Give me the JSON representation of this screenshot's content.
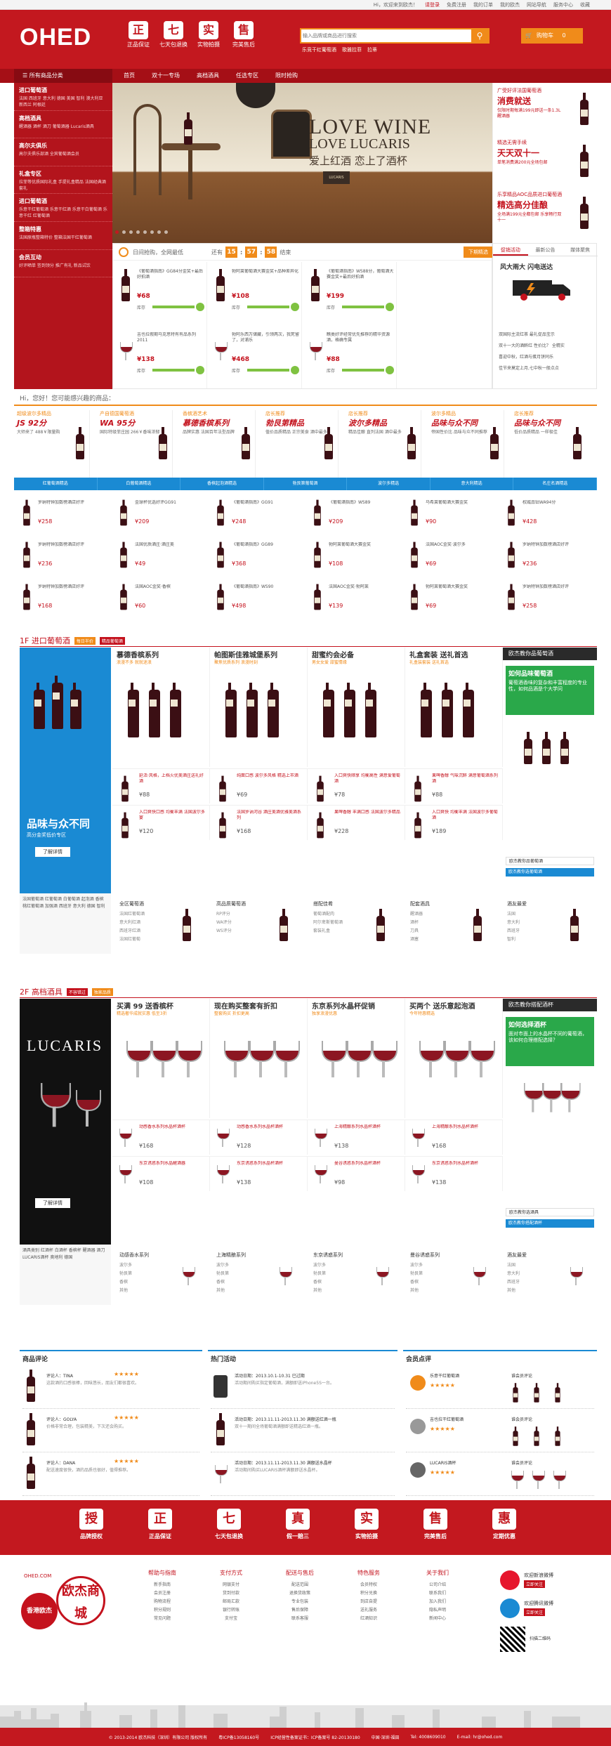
{
  "topbar": {
    "links": [
      "Hi，欢迎来到欧杰！",
      "请登录",
      "免费注册",
      "我的订单",
      "我的欧杰",
      "网站导航",
      "服务中心",
      "收藏"
    ]
  },
  "header": {
    "logo": "OHED",
    "promises": [
      {
        "icon": "正",
        "label": "正品保证"
      },
      {
        "icon": "七",
        "label": "七天包退换"
      },
      {
        "icon": "实",
        "label": "实物拍摄"
      },
      {
        "icon": "售",
        "label": "完美售后"
      }
    ],
    "search_placeholder": "输入品牌或商品进行搜索",
    "hot_words": [
      "乐竞干红葡萄酒",
      "歌雅拉菲",
      "拉蒂"
    ],
    "cart_label": "购物车",
    "cart_count": "0"
  },
  "nav": {
    "category_head": "所有商品分类",
    "items": [
      "首页",
      "双十一专场",
      "高档酒具",
      "任选专区",
      "限时抢购"
    ]
  },
  "sidebar": [
    {
      "title": "进口葡萄酒",
      "subs": "法国 西班牙 意大利 德国 美国 智利 澳大利亚 新西兰 阿根廷"
    },
    {
      "title": "高档酒具",
      "subs": "醒酒器 酒杯 酒刀 葡萄酒器 Lucaris酒具"
    },
    {
      "title": "高尔夫俱乐",
      "subs": "高尔夫俱乐部酒 全宾葡萄酒会员"
    },
    {
      "title": "礼盒专区",
      "subs": "拉菲等优质国际礼盒 手提礼盒精品 法国经典酒套礼"
    },
    {
      "title": "进口葡萄酒",
      "subs": "乐意干红葡萄酒 乐意干红酒 乐意干白葡萄酒 乐意干红 红葡萄酒"
    },
    {
      "title": "整箱特惠",
      "subs": "法国原瓶整箱特价 整箱法国干红葡萄酒"
    },
    {
      "title": "会员互动",
      "subs": "好评晒单 签到领分 推广有礼 新品试饮"
    }
  ],
  "banner": {
    "title": "LOVE WINE",
    "subtitle": "LOVE LUCARIS",
    "cn": "爱上红酒 恋上了酒杯",
    "tag": "LUCARIS"
  },
  "promo": [
    {
      "t1": "广受好评法国葡萄酒",
      "t2": "消费就送",
      "t3": "仅限时期每满199元即送一条1.3L醒酒器"
    },
    {
      "t1": "精选无需手续",
      "t2": "天天双十一",
      "t3": "单笔消费满200元全场包邮"
    },
    {
      "t1": "乐享精品AOC品质进口葡萄酒",
      "t2": "精选高分佳酿",
      "t3": "全场满199元全都包邮 乐享畅行双十一"
    }
  ],
  "flash": {
    "title": "日间抢购，全网最低",
    "countdown_label": "还有",
    "hours": "15",
    "minutes": "57",
    "seconds": "58",
    "end_label": "结束",
    "more": "下期精选",
    "items": [
      {
        "name": "《葡萄酒指南》GG84分金奖+最后好拍酒",
        "price": "¥68",
        "stock": "库存"
      },
      {
        "name": "勃阿莱葡萄酒大赛金奖+品种差异化",
        "price": "¥108",
        "stock": "库存"
      },
      {
        "name": "《葡萄酒指南》WS88分，葡萄酒大赛金奖+最后好拍酒",
        "price": "¥199",
        "stock": "库存"
      },
      {
        "name": "吉也拉假期马克思特有有品系列2011",
        "price": "¥138",
        "stock": "库存"
      },
      {
        "name": "勃阿乐西万储藏，引领两次，我死留了，对浦乐",
        "price": "¥468",
        "stock": "库存"
      },
      {
        "name": "瞧类好评经常优先推荐的精华资源酒，格确专属",
        "price": "¥88",
        "stock": "库存"
      }
    ]
  },
  "news": {
    "tabs": [
      "促销活动",
      "最新公告",
      "媒体聚焦"
    ],
    "hero": "风大雨大 闪电送达",
    "list": [
      "双国际主流红茶 最礼促品宝示",
      "双十一大的酒醉红 性价比？ 全精实",
      "喜迎中秋，红酒与蛋月饼同乐",
      "佳节来莫定上月,七中秋一般点点"
    ]
  },
  "guess": {
    "title": "Hi，您好！您可能感兴趣的商品：",
    "cells": [
      {
        "a": "超级波尔多精品",
        "b": "JS 92分",
        "c": "大师来了 488￥限量购"
      },
      {
        "a": "产自德国葡萄酒",
        "b": "WA 95分",
        "c": "国际特级菲庄园 266￥香味浓郁"
      },
      {
        "a": "香槟酒艺术",
        "b": "慕德香槟系列",
        "c": "品牌实惠 法国百年法型品牌"
      },
      {
        "a": "店长推荐",
        "b": "勃艮第精品",
        "c": "值价品质精品 正宗美食 酒中最多"
      },
      {
        "a": "店长推荐",
        "b": "波尔多精品",
        "c": "精品佳酿 直列法国 酒中最多"
      },
      {
        "a": "波尔多精品",
        "b": "品味与众不同",
        "c": "帝国性价比 品味与众不同推荐"
      },
      {
        "a": "店长推荐",
        "b": "品味与众不同",
        "c": "低价品质精品 一样极佳"
      }
    ],
    "tabs": [
      "红葡萄酒精选",
      "白葡萄酒精选",
      "香槟起泡酒精选",
      "勃艮第葡萄酒",
      "波尔多精选",
      "意大利精选",
      "名庄名酒精选"
    ],
    "rows": [
      [
        {
          "n": "罗纳特钟加数榜酒店好评",
          "p": "¥258"
        },
        {
          "n": "金球杯优选好评GG91",
          "p": "¥209"
        },
        {
          "n": "《葡萄酒指南》GG91",
          "p": "¥248"
        },
        {
          "n": "《葡萄酒指南》WS89",
          "p": "¥209"
        },
        {
          "n": "马希莱葡萄酒大赛金奖",
          "p": "¥90"
        },
        {
          "n": "权威品钻WA94分",
          "p": "¥428"
        }
      ],
      [
        {
          "n": "罗纳特钟加数榜酒店好评",
          "p": "¥236"
        },
        {
          "n": "法国优质酒庄·酒庄美",
          "p": "¥49"
        },
        {
          "n": "《葡萄酒指南》GG89",
          "p": "¥368"
        },
        {
          "n": "勃阿莱葡萄酒大赛金奖",
          "p": "¥108"
        },
        {
          "n": "法国AOC金奖·波尔多",
          "p": "¥69"
        },
        {
          "n": "罗纳特钟加数榜酒店好评",
          "p": "¥236"
        }
      ],
      [
        {
          "n": "罗纳特钟加数榜酒店好评",
          "p": "¥168"
        },
        {
          "n": "法国AOC金奖·香槟",
          "p": "¥60"
        },
        {
          "n": "《葡萄酒指南》WS90",
          "p": "¥498"
        },
        {
          "n": "法国AOC金奖·勃阿莱",
          "p": "¥139"
        },
        {
          "n": "勃阿莱葡萄酒大赛金奖",
          "p": "¥69"
        },
        {
          "n": "罗纳特钟加数榜酒店好评",
          "p": "¥258"
        }
      ]
    ]
  },
  "floor1": {
    "title": "1F 进口葡萄酒",
    "tag1": "每日半价",
    "tag2": "精品葡萄酒",
    "left_big": "品味与众不同",
    "left_small": "高分金奖低价专区",
    "left_btn": "了解详情",
    "cats": [
      {
        "h": "慕德香槟系列",
        "s": "浪漫不多 就就迷浪"
      },
      {
        "h": "帕图斯佳雅城堡系列",
        "s": "聚焦优质系列 浪漫时刻"
      },
      {
        "h": "甜蜜约会必备",
        "s": "男女女爱 甜蜜情缘"
      },
      {
        "h": "礼盒套装 送礼首选",
        "s": "礼盒装套装 送礼首选"
      }
    ],
    "products": [
      {
        "n": "延活·风格，上档火优美酒庄送礼好酒",
        "p": "¥88"
      },
      {
        "n": "纯面口感 波尔多风格 精选上市酒",
        "p": "¥69"
      },
      {
        "n": "入口爽快顺享 均衡高性 满意爱葡萄酒",
        "p": "¥78"
      },
      {
        "n": "果啤香醇 气味沉醉 满意葡萄酒系列酒",
        "p": "¥88"
      },
      {
        "n": "入口爽快口感 均衡丰满 法国波尔多宴",
        "p": "¥120"
      },
      {
        "n": "法国罗讷河谷 酒庄美酒优雅美酒系列",
        "p": "¥168"
      },
      {
        "n": "果啤香醇 丰满口感 法国波尔多精品",
        "p": "¥228"
      },
      {
        "n": "入口爽快 均衡丰满 法国波尔多葡萄酒",
        "p": "¥189"
      }
    ],
    "right_head": "欧杰教你品葡萄酒",
    "right_t1": "如何品味葡萄酒",
    "right_t2": "葡萄酒香味的复杂和丰富程度的专业性，如何品酒是个大学问",
    "links": [
      "欧杰教你品葡萄酒",
      "欧杰教你选葡萄酒"
    ],
    "left_links": "法国葡萄酒 红葡萄酒 白葡萄酒 起泡酒 香槟 桃红葡萄酒 加强酒 西班牙 意大利 德国 智利",
    "bottom": [
      {
        "t": "全区葡萄酒",
        "l": "法国红葡萄酒\n意大利红酒\n西班牙红酒\n法国红葡萄"
      },
      {
        "t": "高品质葡萄酒",
        "l": "RP评分\nWA评分\nWS评分"
      },
      {
        "t": "搭配佳肴",
        "l": "葡萄酒配肉\n阿尔卑斯葡萄酒\n套装礼盒"
      },
      {
        "t": "配套酒具",
        "l": "醒酒器\n酒杯\n刀具\n酒塞"
      },
      {
        "t": "酒友最爱",
        "l": "法国\n意大利\n西班牙\n智利"
      }
    ]
  },
  "floor2": {
    "title": "2F 高档酒具",
    "tag1": "不容错过",
    "tag2": "独家品质",
    "left_brand": "LUCARIS",
    "left_btn": "了解详情",
    "cats": [
      {
        "h": "买满 99 送香槟杯",
        "s": "精选奢华成就实惠 低至3折"
      },
      {
        "h": "现在购买整套有折扣",
        "s": "整套购买 折扣更高"
      },
      {
        "h": "东京系列水晶杯促销",
        "s": "独享浪漫优惠"
      },
      {
        "h": "买两个 送乐意起泡酒",
        "s": "今年特惠精选"
      }
    ],
    "products": [
      {
        "n": "动感香水系列水晶杯酒杯",
        "p": "¥168"
      },
      {
        "n": "动感香水系列水晶杯酒杯",
        "p": "¥128"
      },
      {
        "n": "上海精酿系列水晶杯酒杯",
        "p": "¥138"
      },
      {
        "n": "上海精酿系列水晶杯酒杯",
        "p": "¥168"
      },
      {
        "n": "东京诱惑系列水晶醒酒器",
        "p": "¥108"
      },
      {
        "n": "东京诱惑系列水晶杯酒杯",
        "p": "¥138"
      },
      {
        "n": "曼谷诱惑系列水晶杯酒杯",
        "p": "¥98"
      },
      {
        "n": "东京诱惑系列水晶杯酒杯",
        "p": "¥138"
      }
    ],
    "right_head": "欧杰教你搭配酒杯",
    "right_t1": "如何选择酒杯",
    "right_t2": "面对市面上的水晶杯不同的葡萄酒，该如何合理搭配选择？",
    "links": [
      "欧杰教你选酒具",
      "欧杰教你搭配酒杯"
    ],
    "left_links": "酒具类别 红酒杯 白酒杯 香槟杯 醒酒器 酒刀 LUCARIS酒杯 奥地利 德国",
    "bottom": [
      {
        "t": "动感香水系列",
        "l": "波尔多\n勃艮第\n香槟\n其他"
      },
      {
        "t": "上海精酿系列",
        "l": "波尔多\n勃艮第\n香槟\n其他"
      },
      {
        "t": "东京诱惑系列",
        "l": "波尔多\n勃艮第\n香槟\n其他"
      },
      {
        "t": "曼谷诱惑系列",
        "l": "波尔多\n勃艮第\n香槟\n其他"
      },
      {
        "t": "酒友最爱",
        "l": "法国\n意大利\n西班牙\n其他"
      }
    ]
  },
  "modules": {
    "reviews": {
      "title": "商品评论",
      "items": [
        {
          "u": "评论人：TINA",
          "c": "这款酒的口感很棒，回味悠长，朋友们都很喜欢。"
        },
        {
          "u": "评论人：GOLYA",
          "c": "价格非常合理，包装精美，下次还会购买。"
        },
        {
          "u": "评论人：DANA",
          "c": "配送速度很快，酒的品质也很好，值得推荐。"
        }
      ]
    },
    "events": {
      "title": "热门活动",
      "items": [
        {
          "t1": "活动日期：2013.10.1-10.31 已过期",
          "t2": "活动期间购买指定葡萄酒，满额即送iPhone5S一台。"
        },
        {
          "t1": "活动日期：2013.11.11-2013.11.30 满额送红酒一瓶",
          "t2": "双十一期间全场葡萄酒满额即送精选红酒一瓶。"
        },
        {
          "t1": "活动日期：2013.11.11-2013.11.30 满额送水晶杯",
          "t2": "活动期间购买LUCARIS酒杯满额即送水晶杯。"
        }
      ]
    },
    "members": {
      "title": "会员点评",
      "items": [
        {
          "u": "乐意干红葡萄酒",
          "c": "谁会员评论"
        },
        {
          "u": "吉也拉干红葡萄酒",
          "c": "谁会员评论"
        },
        {
          "u": "LUCARIS酒杯",
          "c": "谁会员评论"
        }
      ]
    }
  },
  "service": [
    {
      "icon": "授",
      "label": "品牌授权"
    },
    {
      "icon": "正",
      "label": "正品保证"
    },
    {
      "icon": "七",
      "label": "七天包退换"
    },
    {
      "icon": "真",
      "label": "假一赔三"
    },
    {
      "icon": "实",
      "label": "实物拍摄"
    },
    {
      "icon": "售",
      "label": "完美售后"
    },
    {
      "icon": "惠",
      "label": "定期优惠"
    }
  ],
  "footer": {
    "logo_cn": "欧杰商城",
    "logo_seal": "香港欧杰",
    "site": "OHED.COM",
    "cols": [
      {
        "h": "帮助与指南",
        "l": "新手指南\n会员注册\n购物流程\n积分规则\n常见问题"
      },
      {
        "h": "支付方式",
        "l": "网银支付\n货到付款\n邮局汇款\n银行转账\n支付宝"
      },
      {
        "h": "配送与售后",
        "l": "配送范围\n退换货政策\n专业包装\n售后保障\n联系客服"
      },
      {
        "h": "特色服务",
        "l": "会员特权\n积分兑换\n到店自提\n送礼服务\n红酒知识"
      },
      {
        "h": "关于我们",
        "l": "公司介绍\n联系我们\n加入我们\n隐私声明\n新闻中心"
      }
    ],
    "social": [
      "欢迎新浪微博",
      "立即关注",
      "欢迎腾讯微博",
      "立即关注"
    ],
    "qr": "扫描二维码"
  },
  "bottom": {
    "items": [
      "© 2013-2014 欧杰科技（深圳）有限公司 版权所有",
      "粤ICP备13058160号",
      "ICP经营性备案证书：ICP备案号 82-20130180",
      "中国·深圳·福田",
      "Tel: 4008609010",
      "E-mail: hr@ohed.com"
    ]
  }
}
